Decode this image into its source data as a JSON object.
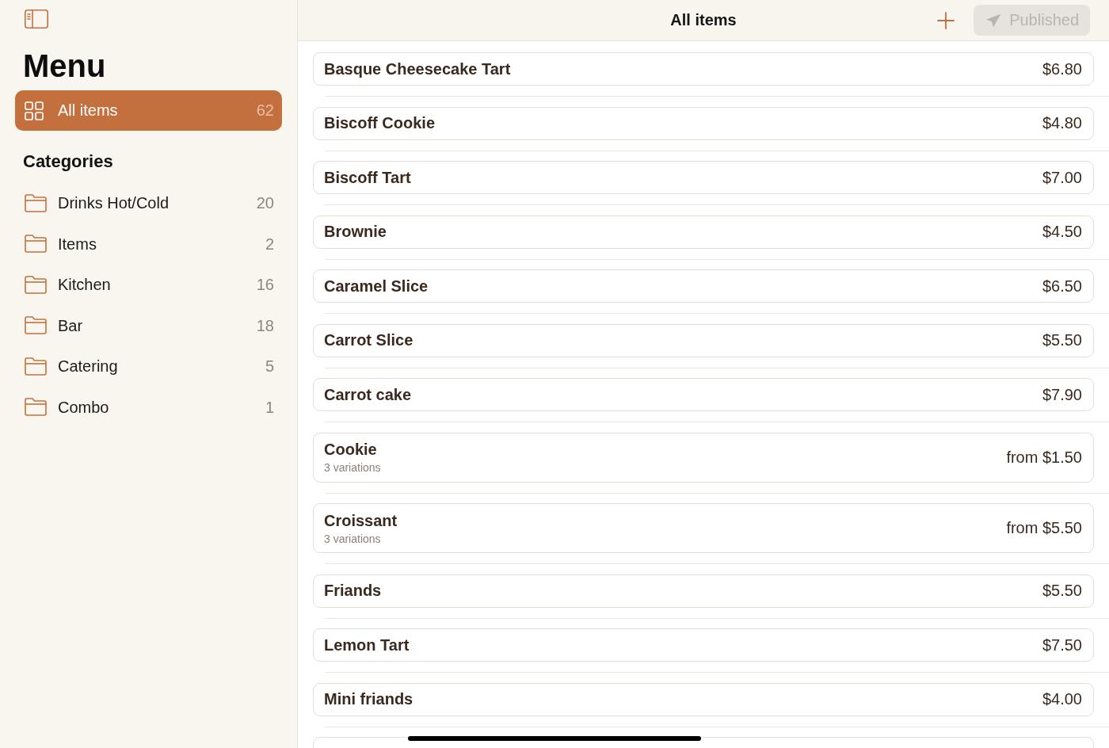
{
  "sidebar": {
    "title": "Menu",
    "all_items": {
      "label": "All items",
      "count": "62",
      "selected": true
    },
    "categories_heading": "Categories",
    "categories": [
      {
        "label": "Drinks Hot/Cold",
        "count": "20",
        "selected": false
      },
      {
        "label": "Items",
        "count": "2",
        "selected": false
      },
      {
        "label": "Kitchen",
        "count": "16",
        "selected": false
      },
      {
        "label": "Bar",
        "count": "18",
        "selected": false
      },
      {
        "label": "Catering",
        "count": "5",
        "selected": false
      },
      {
        "label": "Combo",
        "count": "1",
        "selected": false
      }
    ]
  },
  "header": {
    "title": "All items",
    "publish_button": {
      "label": "Published",
      "disabled": true
    }
  },
  "items": [
    {
      "name": "Basque Cheesecake Tart",
      "price": "$6.80"
    },
    {
      "name": "Biscoff Cookie",
      "price": "$4.80"
    },
    {
      "name": "Biscoff Tart",
      "price": "$7.00"
    },
    {
      "name": "Brownie",
      "price": "$4.50"
    },
    {
      "name": "Caramel Slice",
      "price": "$6.50"
    },
    {
      "name": "Carrot Slice",
      "price": "$5.50"
    },
    {
      "name": "Carrot cake",
      "price": "$7.90"
    },
    {
      "name": "Cookie",
      "price": "from $1.50",
      "variations": "3 variations"
    },
    {
      "name": "Croissant",
      "price": "from $5.50",
      "variations": "3 variations"
    },
    {
      "name": "Friands",
      "price": "$5.50"
    },
    {
      "name": "Lemon Tart",
      "price": "$7.50"
    },
    {
      "name": "Mini friands",
      "price": "$4.00"
    }
  ]
}
